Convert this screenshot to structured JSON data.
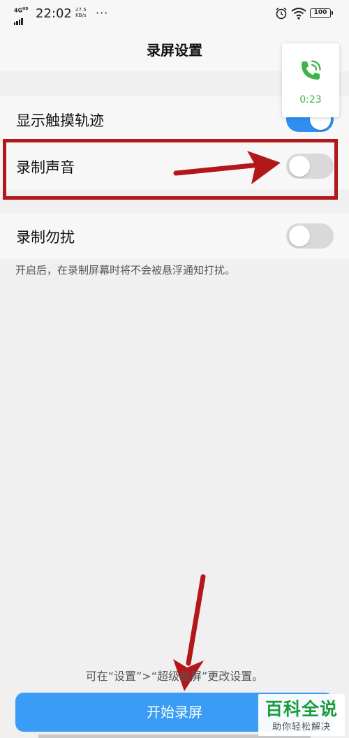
{
  "status_bar": {
    "network": "4G",
    "network_sup": "HD",
    "time": "22:02",
    "speed_value": "27.5",
    "speed_unit": "KB/s",
    "more": "···",
    "battery": "100"
  },
  "header": {
    "title": "录屏设置"
  },
  "settings": {
    "show_touch": {
      "label": "显示触摸轨迹",
      "on": true
    },
    "record_sound": {
      "label": "录制声音",
      "on": false
    },
    "dnd": {
      "label": "录制勿扰",
      "on": false
    },
    "dnd_note": "开启后，在录制屏幕时将不会被悬浮通知打扰。"
  },
  "call_widget": {
    "timer": "0:23",
    "icon": "phone-icon",
    "color": "#3db34a"
  },
  "footer": {
    "hint": "可在“设置”>“超级截屏”更改设置。",
    "start_button": "开始录屏"
  },
  "watermark": {
    "title": "百科全说",
    "subtitle": "助你轻松解决"
  },
  "colors": {
    "accent": "#2f8ef2",
    "button": "#3a9cf5",
    "annotation": "#b3171a",
    "background": "#f0f0f0"
  }
}
